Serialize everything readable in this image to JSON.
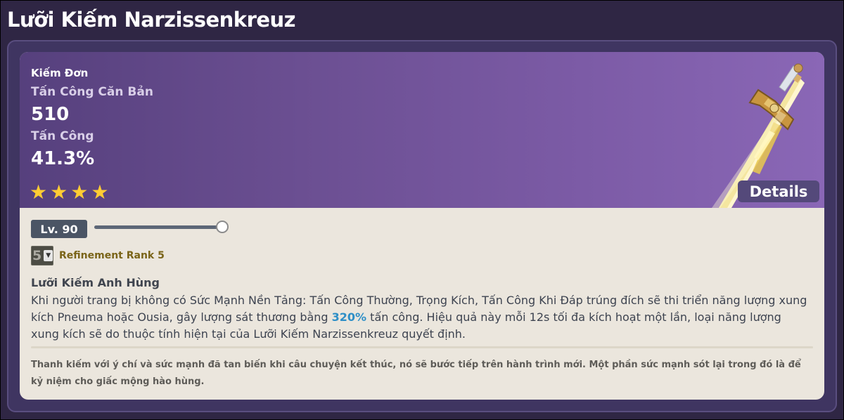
{
  "page": {
    "title": "Lưỡi Kiếm Narzissenkreuz"
  },
  "weapon": {
    "type": "Kiếm Đơn",
    "base_atk_label": "Tấn Công Căn Bản",
    "base_atk_value": "510",
    "sub_stat_label": "Tấn Công",
    "sub_stat_value": "41.3%",
    "rarity_stars": 4,
    "star_glyph": "★",
    "image_icon": "sword-image",
    "details_label": "Details"
  },
  "level": {
    "label": "Lv. 90",
    "slider_fraction": 1.0
  },
  "refinement": {
    "selected": "5",
    "label": "Refinement Rank 5"
  },
  "passive": {
    "title": "Lưỡi Kiếm Anh Hùng",
    "desc_part1": "Khi người trang bị không có Sức Mạnh Nền Tảng: Tấn Công Thường, Trọng Kích, Tấn Công Khi Đáp trúng đích sẽ thi triển năng lượng xung kích Pneuma hoặc Ousia, gây lượng sát thương bằng ",
    "desc_highlight": "320%",
    "desc_part2": " tấn công. Hiệu quả này mỗi 12s tối đa kích hoạt một lần, loại năng lượng xung kích sẽ do thuộc tính hiện tại của Lưỡi Kiếm Narzissenkreuz quyết định."
  },
  "lore": "Thanh kiếm với ý chí và sức mạnh đã tan biến khi câu chuyện kết thúc, nó sẽ bước tiếp trên hành trình mới. Một phần sức mạnh sót lại trong đó là để kỷ niệm cho giấc mộng hào hùng.",
  "colors": {
    "header_start": "#56407d",
    "header_end": "#8a67b6",
    "star": "#ffcc33",
    "highlight": "#2e8fc7",
    "refine_label": "#7a6418"
  }
}
